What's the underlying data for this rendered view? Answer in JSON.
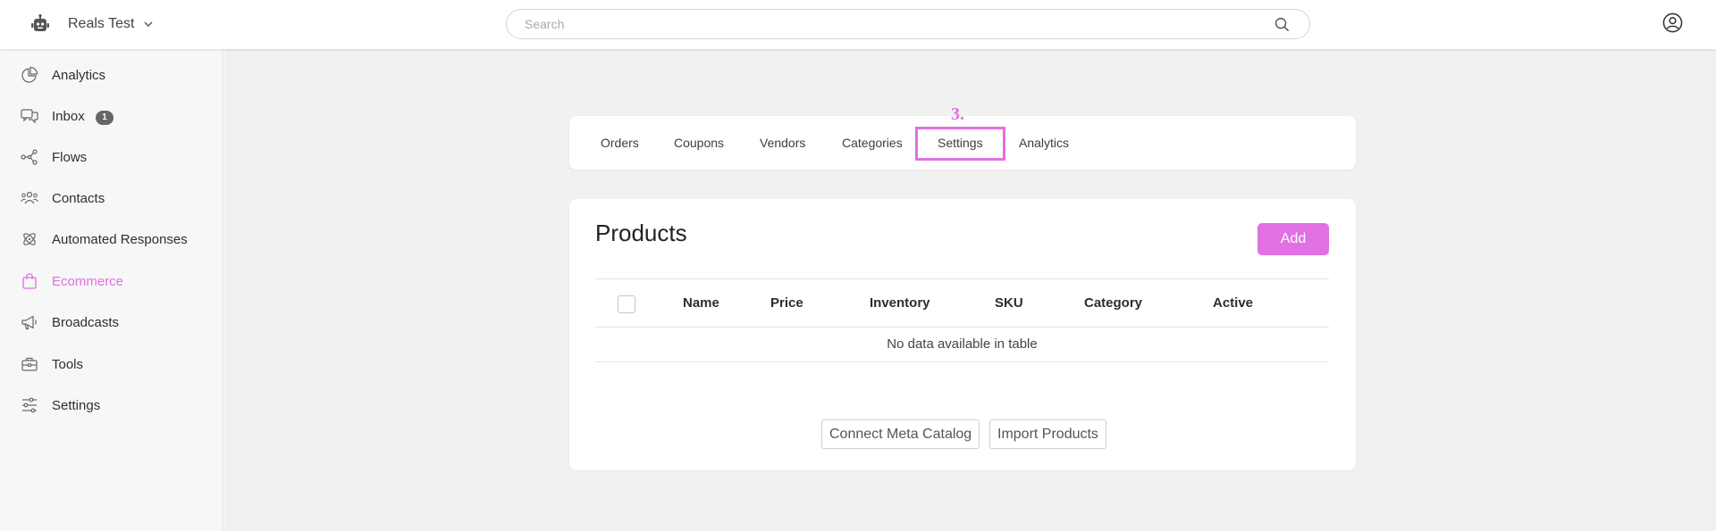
{
  "header": {
    "app_name": "Reals Test",
    "search_placeholder": "Search"
  },
  "sidebar": {
    "items": [
      {
        "label": "Analytics",
        "icon": "pie-chart-icon"
      },
      {
        "label": "Inbox",
        "icon": "chat-bubbles-icon",
        "badge": "1"
      },
      {
        "label": "Flows",
        "icon": "flow-icon"
      },
      {
        "label": "Contacts",
        "icon": "contacts-icon"
      },
      {
        "label": "Automated Responses",
        "icon": "atom-icon"
      },
      {
        "label": "Ecommerce",
        "icon": "shopping-bag-icon",
        "active": true
      },
      {
        "label": "Broadcasts",
        "icon": "megaphone-icon"
      },
      {
        "label": "Tools",
        "icon": "toolbox-icon"
      },
      {
        "label": "Settings",
        "icon": "sliders-icon"
      }
    ]
  },
  "tabs": [
    "Orders",
    "Coupons",
    "Vendors",
    "Categories",
    "Settings",
    "Analytics"
  ],
  "annotation": {
    "step_label": "3."
  },
  "products": {
    "title": "Products",
    "add_label": "Add",
    "columns": [
      "Name",
      "Price",
      "Inventory",
      "SKU",
      "Category",
      "Active"
    ],
    "empty_message": "No data available in table",
    "connect_label": "Connect Meta Catalog",
    "import_label": "Import Products"
  },
  "colors": {
    "accent": "#e070e3",
    "sidebar_bg": "#f7f7f7",
    "main_bg": "#f1f1f1"
  }
}
